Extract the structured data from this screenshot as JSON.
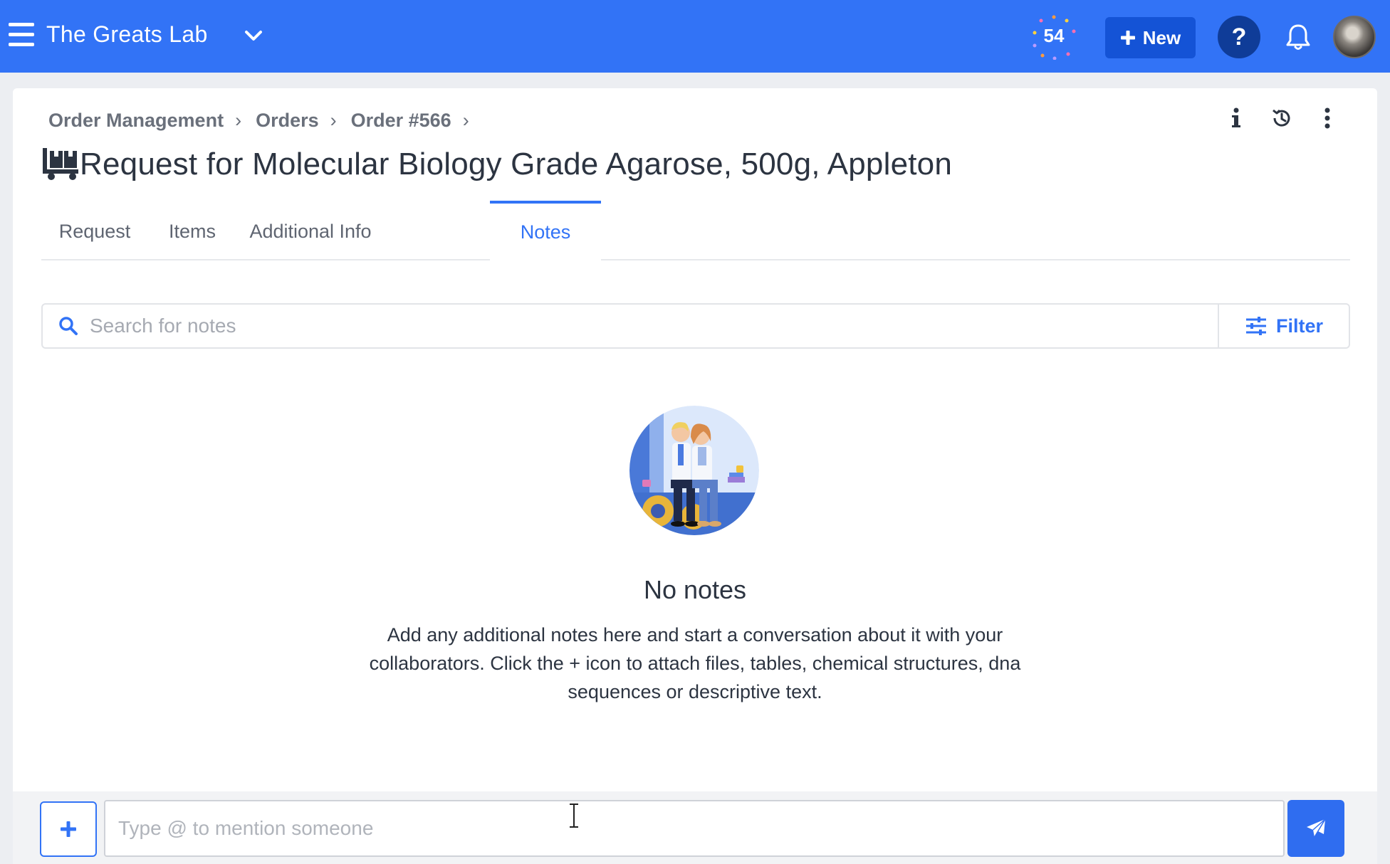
{
  "topbar": {
    "lab_name": "The Greats Lab",
    "score": "54",
    "new_label": "New",
    "help_label": "?"
  },
  "breadcrumb": [
    {
      "label": "Order Management"
    },
    {
      "label": "Orders"
    },
    {
      "label": "Order #566"
    }
  ],
  "page": {
    "title": "Request for Molecular Biology Grade Agarose, 500g, Appleton"
  },
  "tabs": [
    {
      "label": "Request",
      "active": false
    },
    {
      "label": "Items",
      "active": false
    },
    {
      "label": "Additional Info",
      "active": false
    },
    {
      "label": "Notes",
      "active": true
    }
  ],
  "search": {
    "placeholder": "Search for notes",
    "filter_label": "Filter"
  },
  "empty_state": {
    "title": "No notes",
    "description": "Add any additional notes here and start a conversation about it with your collaborators. Click the + icon to attach files, tables, chemical structures, dna sequences or descriptive text."
  },
  "composer": {
    "placeholder": "Type @ to mention someone"
  },
  "colors": {
    "brand": "#3273f6",
    "brand_dark": "#1453d6",
    "help_bg": "#0f3c98"
  }
}
